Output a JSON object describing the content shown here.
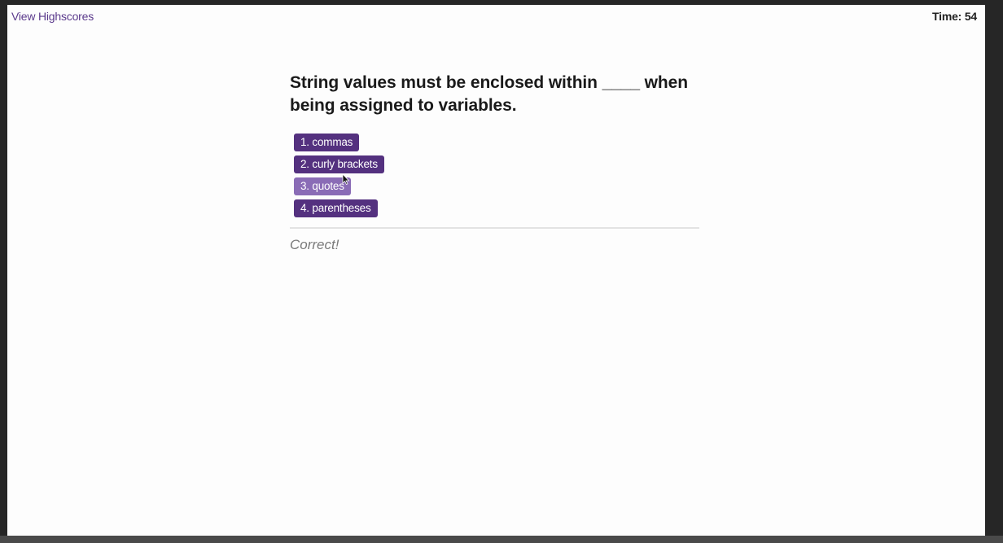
{
  "header": {
    "highscores_label": "View Highscores",
    "timer_label": "Time: ",
    "timer_value": "54"
  },
  "quiz": {
    "question": "String values must be enclosed within ____ when being assigned to variables.",
    "choices": [
      {
        "label": "1. commas"
      },
      {
        "label": "2. curly brackets"
      },
      {
        "label": "3. quotes"
      },
      {
        "label": "4. parentheses"
      }
    ],
    "hovered_choice_index": 2,
    "feedback": "Correct!"
  },
  "colors": {
    "accent": "#54317f",
    "accent_hover": "#8a6cb6",
    "link": "#5b3a8c",
    "feedback": "#7a7a7a"
  },
  "icons": {
    "cursor": "mouse-pointer-icon"
  }
}
